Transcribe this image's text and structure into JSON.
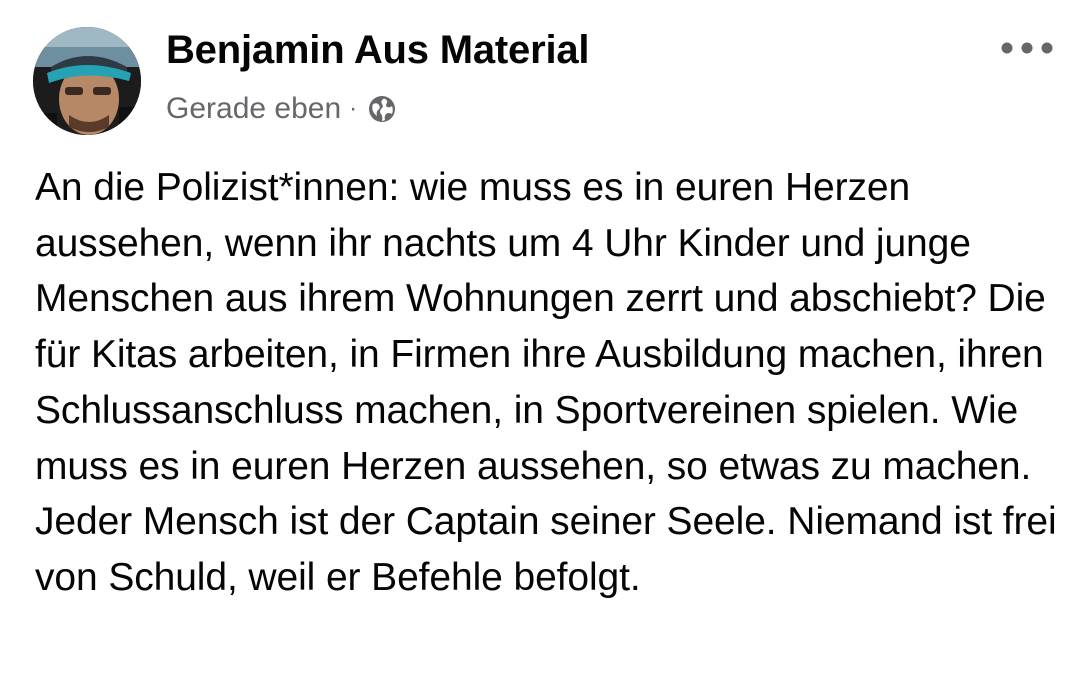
{
  "post": {
    "author_name": "Benjamin Aus Material",
    "timestamp": "Gerade eben",
    "separator": "·",
    "audience_icon": "globe-icon",
    "more_icon": "more-options-icon",
    "text": "An die Polizist*innen: wie muss es in euren Herzen aussehen, wenn ihr nachts um 4 Uhr Kinder und junge Menschen aus ihrem Wohnungen zerrt und abschiebt? Die für Kitas arbeiten, in Firmen ihre Ausbildung machen, ihren Schlussanschluss machen, in Sportvereinen spielen. Wie muss es in euren Herzen aussehen, so etwas zu machen. Jeder Mensch ist der Captain seiner Seele. Niemand ist frei von Schuld, weil er Befehle befolgt."
  },
  "colors": {
    "text_primary": "#050505",
    "text_secondary": "#65676b",
    "background": "#ffffff"
  }
}
